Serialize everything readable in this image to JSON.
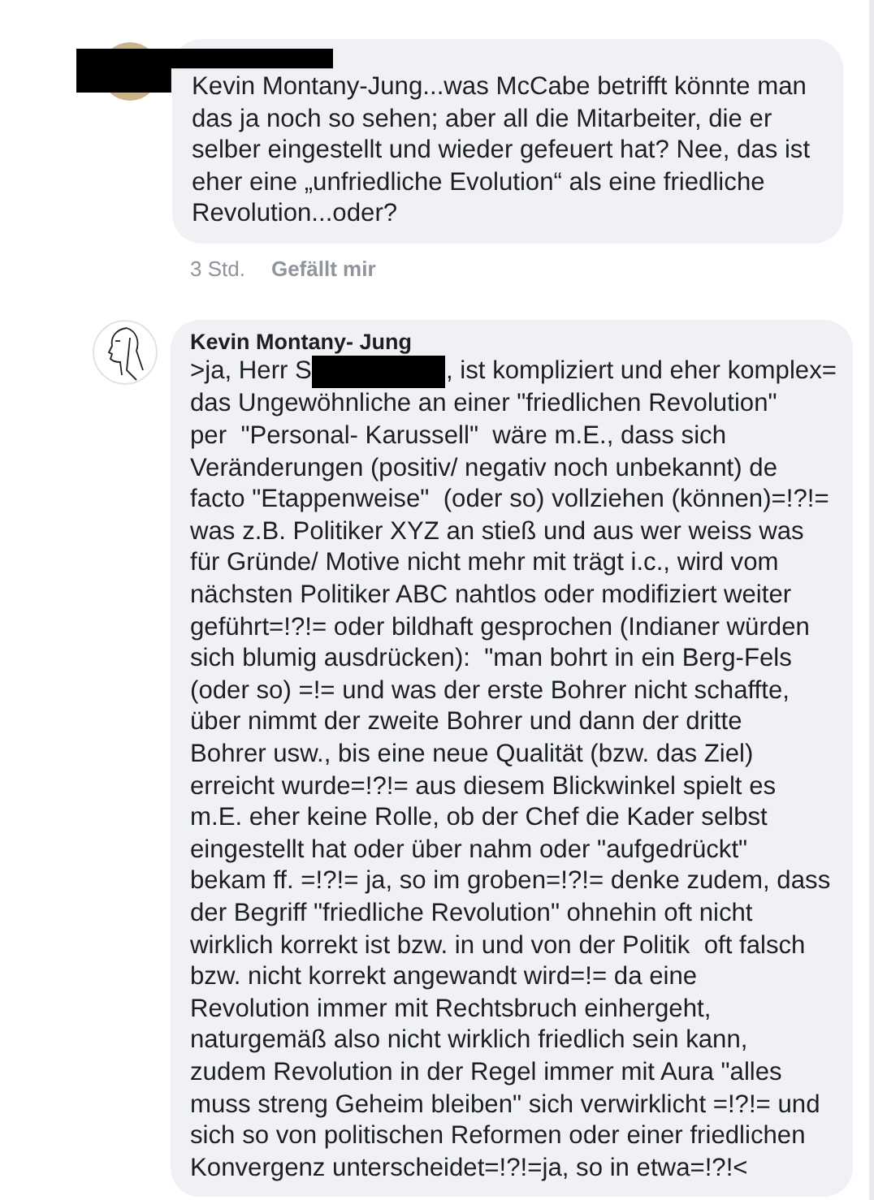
{
  "comments": [
    {
      "avatar": {
        "kind": "photo"
      },
      "author_redacted": true,
      "body": "Kevin Montany-Jung...was McCabe betrifft könnte man das ja noch so sehen; aber all die Mitarbeiter, die er selber eingestellt und wieder gefeuert hat? Nee, das ist eher eine „unfriedliche Evolution“ als eine friedliche Revolution...oder?",
      "time": "3 Std.",
      "like": "Gefällt mir"
    },
    {
      "avatar": {
        "kind": "sketch"
      },
      "author": "Kevin Montany- Jung",
      "first_line": [
        ">ja, Herr S",
        ", ist kompliziert und eher komplex="
      ],
      "first_line_redacted": true,
      "body": "das Ungewöhnliche an einer \"friedlichen Revolution\"\nper  \"Personal- Karussell\"  wäre m.E., dass sich\nVeränderungen (positiv/ negativ noch unbekannt) de\nfacto \"Etappenweise\"  (oder so) vollziehen (können)=!?!=\nwas z.B. Politiker XYZ an stieß und aus wer weiss was\nfür Gründe/ Motive nicht mehr mit trägt i.c., wird vom\nnächsten Politiker ABC nahtlos oder modifiziert weiter\ngeführt=!?!= oder bildhaft gesprochen (Indianer würden\nsich blumig ausdrücken):  \"man bohrt in ein Berg-Fels\n(oder so) =!= und was der erste Bohrer nicht schaffte,\nüber nimmt der zweite Bohrer und dann der dritte\nBohrer usw., bis eine neue Qualität (bzw. das Ziel)\nerreicht wurde=!?!= aus diesem Blickwinkel spielt es\nm.E. eher keine Rolle, ob der Chef die Kader selbst\neingestellt hat oder über nahm oder \"aufgedrückt\"\nbekam ff. =!?!= ja, so im groben=!?!= denke zudem, dass\nder Begriff \"friedliche Revolution\" ohnehin oft nicht\nwirklich korrekt ist bzw. in und von der Politik  oft falsch\nbzw. nicht korrekt angewandt wird=!= da eine\nRevolution immer mit Rechtsbruch einhergeht,\nnaturgemäß also nicht wirklich friedlich sein kann,\nzudem Revolution in der Regel immer mit Aura \"alles\nmuss streng Geheim bleiben\" sich verwirklicht =!?!= und\nsich so von politischen Reformen oder einer friedlichen\nKonvergenz unterscheidet=!?!=ja, so in etwa=!?!<"
    }
  ]
}
